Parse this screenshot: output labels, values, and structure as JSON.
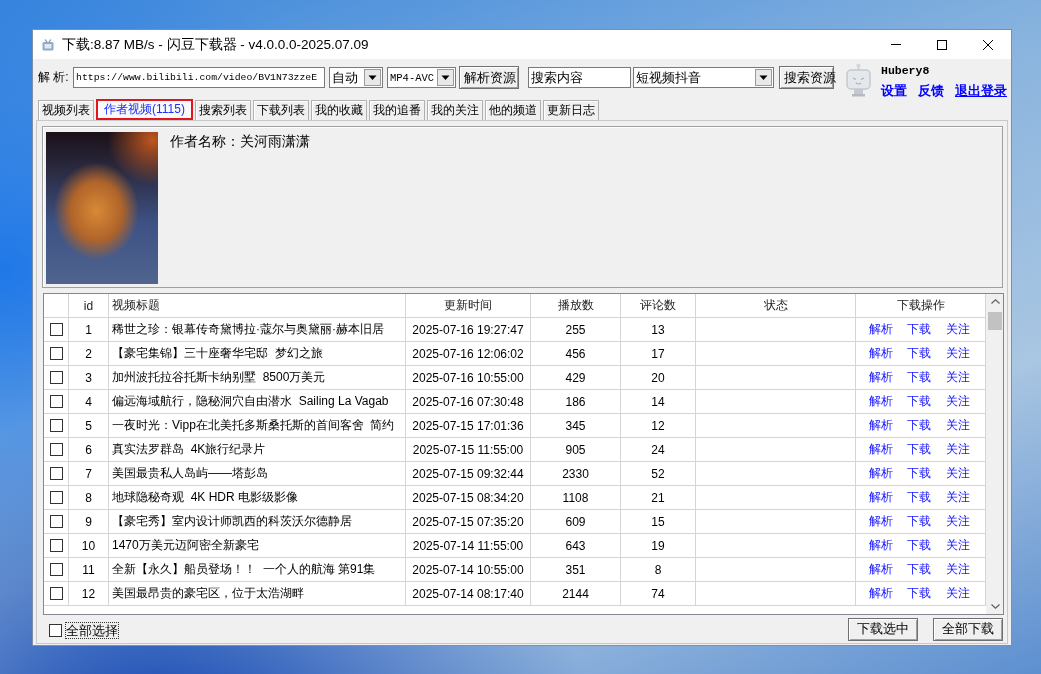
{
  "window": {
    "title": "下载:8.87 MB/s - 闪豆下载器 - v4.0.0.0-2025.07.09"
  },
  "toolbar": {
    "label": "解 析:",
    "url": {
      "value": "https://www.bilibili.com/video/BV1N73zzeE"
    },
    "quality": {
      "value": "自动"
    },
    "format": {
      "value": "MP4-AVC"
    },
    "parse_button": "解析资源",
    "search": {
      "value": "搜索内容"
    },
    "platform": {
      "value": "短视频抖音"
    },
    "search_button": "搜索资源"
  },
  "user": {
    "name": "Hubery8",
    "links": [
      {
        "label": "设置",
        "underlined": false
      },
      {
        "label": "反馈",
        "underlined": false
      },
      {
        "label": "退出登录",
        "underlined": true
      }
    ]
  },
  "tabs": [
    {
      "label": "视频列表",
      "selected": false
    },
    {
      "label": "作者视频(1115)",
      "selected": true
    },
    {
      "label": "搜索列表",
      "selected": false
    },
    {
      "label": "下载列表",
      "selected": false
    },
    {
      "label": "我的收藏",
      "selected": false
    },
    {
      "label": "我的追番",
      "selected": false
    },
    {
      "label": "我的关注",
      "selected": false
    },
    {
      "label": "他的频道",
      "selected": false
    },
    {
      "label": "更新日志",
      "selected": false
    }
  ],
  "author": {
    "name_text": "作者名称：关河雨潇潇"
  },
  "table": {
    "columns": [
      "id",
      "视频标题",
      "更新时间",
      "播放数",
      "评论数",
      "状态",
      "下载操作"
    ],
    "rows": [
      {
        "checked": false,
        "id": "1",
        "title": "稀世之珍：银幕传奇黛博拉·蔻尔与奥黛丽·赫本旧居",
        "updated": "2025-07-16 19:27:47",
        "plays": "255",
        "comments": "13",
        "actions": [
          "解析",
          "下载",
          "关注"
        ]
      },
      {
        "checked": false,
        "id": "2",
        "title": "【豪宅集锦】三十座奢华宅邸  梦幻之旅",
        "updated": "2025-07-16 12:06:02",
        "plays": "456",
        "comments": "17",
        "actions": [
          "解析",
          "下载",
          "关注"
        ]
      },
      {
        "checked": false,
        "id": "3",
        "title": "加州波托拉谷托斯卡纳别墅  8500万美元",
        "updated": "2025-07-16 10:55:00",
        "plays": "429",
        "comments": "20",
        "actions": [
          "解析",
          "下载",
          "关注"
        ]
      },
      {
        "checked": false,
        "id": "4",
        "title": "偏远海域航行，隐秘洞穴自由潜水  Sailing La Vagab",
        "updated": "2025-07-16 07:30:48",
        "plays": "186",
        "comments": "14",
        "actions": [
          "解析",
          "下载",
          "关注"
        ]
      },
      {
        "checked": false,
        "id": "5",
        "title": "一夜时光：Vipp在北美托多斯桑托斯的首间客舍  简约",
        "updated": "2025-07-15 17:01:36",
        "plays": "345",
        "comments": "12",
        "actions": [
          "解析",
          "下载",
          "关注"
        ]
      },
      {
        "checked": false,
        "id": "6",
        "title": "真实法罗群岛  4K旅行纪录片",
        "updated": "2025-07-15 11:55:00",
        "plays": "905",
        "comments": "24",
        "actions": [
          "解析",
          "下载",
          "关注"
        ]
      },
      {
        "checked": false,
        "id": "7",
        "title": "美国最贵私人岛屿——塔彭岛",
        "updated": "2025-07-15 09:32:44",
        "plays": "2330",
        "comments": "52",
        "actions": [
          "解析",
          "下载",
          "关注"
        ]
      },
      {
        "checked": false,
        "id": "8",
        "title": "地球隐秘奇观  4K HDR 电影级影像",
        "updated": "2025-07-15 08:34:20",
        "plays": "1108",
        "comments": "21",
        "actions": [
          "解析",
          "下载",
          "关注"
        ]
      },
      {
        "checked": false,
        "id": "9",
        "title": "【豪宅秀】室内设计师凯西的科茨沃尔德静居",
        "updated": "2025-07-15 07:35:20",
        "plays": "609",
        "comments": "15",
        "actions": [
          "解析",
          "下载",
          "关注"
        ]
      },
      {
        "checked": false,
        "id": "10",
        "title": "1470万美元迈阿密全新豪宅",
        "updated": "2025-07-14 11:55:00",
        "plays": "643",
        "comments": "19",
        "actions": [
          "解析",
          "下载",
          "关注"
        ]
      },
      {
        "checked": false,
        "id": "11",
        "title": "全新【永久】船员登场！！  一个人的航海 第91集",
        "updated": "2025-07-14 10:55:00",
        "plays": "351",
        "comments": "8",
        "actions": [
          "解析",
          "下载",
          "关注"
        ]
      },
      {
        "checked": false,
        "id": "12",
        "title": "美国最昂贵的豪宅区，位于太浩湖畔",
        "updated": "2025-07-14 08:17:40",
        "plays": "2144",
        "comments": "74",
        "actions": [
          "解析",
          "下载",
          "关注"
        ]
      }
    ]
  },
  "footer": {
    "select_all": {
      "label": "全部选择",
      "checked": false
    },
    "buttons": [
      "下载选中",
      "全部下载"
    ]
  }
}
